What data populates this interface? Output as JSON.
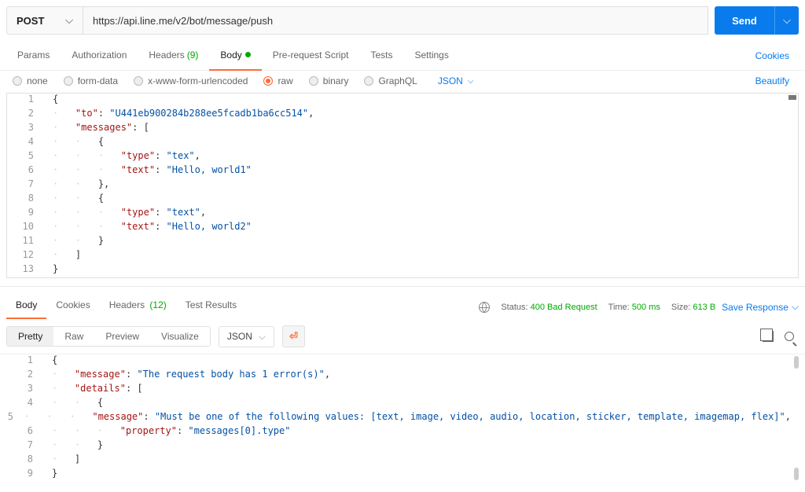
{
  "request": {
    "method": "POST",
    "url": "https://api.line.me/v2/bot/message/push",
    "send_label": "Send"
  },
  "tabs": {
    "params": "Params",
    "auth": "Authorization",
    "headers": "Headers",
    "headers_count": "(9)",
    "body": "Body",
    "prerequest": "Pre-request Script",
    "tests": "Tests",
    "settings": "Settings",
    "cookies": "Cookies"
  },
  "body_subtabs": {
    "none": "none",
    "form_data": "form-data",
    "xwww": "x-www-form-urlencoded",
    "raw": "raw",
    "binary": "binary",
    "graphql": "GraphQL",
    "format": "JSON",
    "beautify": "Beautify"
  },
  "request_body": {
    "to": "U441eb900284b288ee5fcadb1ba6cc514",
    "messages": [
      {
        "type": "tex",
        "text": "Hello, world1"
      },
      {
        "type": "text",
        "text": "Hello, world2"
      }
    ]
  },
  "response_tabs": {
    "body": "Body",
    "cookies": "Cookies",
    "headers": "Headers",
    "headers_count": "(12)",
    "test_results": "Test Results"
  },
  "response_meta": {
    "status_label": "Status:",
    "status_value": "400 Bad Request",
    "time_label": "Time:",
    "time_value": "500 ms",
    "size_label": "Size:",
    "size_value": "613 B",
    "save_response": "Save Response"
  },
  "response_toolbar": {
    "pretty": "Pretty",
    "raw": "Raw",
    "preview": "Preview",
    "visualize": "Visualize",
    "format": "JSON"
  },
  "response_body": {
    "message": "The request body has 1 error(s)",
    "details": [
      {
        "message": "Must be one of the following values: [text, image, video, audio, location, sticker, template, imagemap, flex]",
        "property": "messages[0].type"
      }
    ]
  }
}
